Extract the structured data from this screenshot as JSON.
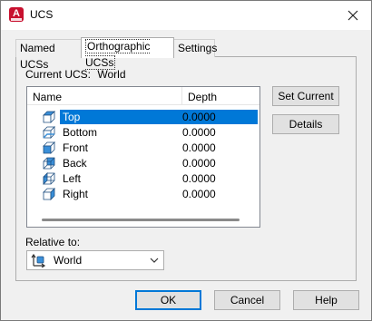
{
  "window": {
    "title": "UCS",
    "app_icon_letter": "A"
  },
  "tabs": [
    {
      "label": "Named UCSs",
      "active": false
    },
    {
      "label": "Orthographic UCSs",
      "active": true
    },
    {
      "label": "Settings",
      "active": false
    }
  ],
  "current_ucs": {
    "label": "Current UCS:",
    "value": "World"
  },
  "list": {
    "columns": {
      "name": "Name",
      "depth": "Depth"
    },
    "rows": [
      {
        "name": "Top",
        "depth": "0.0000",
        "selected": true
      },
      {
        "name": "Bottom",
        "depth": "0.0000",
        "selected": false
      },
      {
        "name": "Front",
        "depth": "0.0000",
        "selected": false
      },
      {
        "name": "Back",
        "depth": "0.0000",
        "selected": false
      },
      {
        "name": "Left",
        "depth": "0.0000",
        "selected": false
      },
      {
        "name": "Right",
        "depth": "0.0000",
        "selected": false
      }
    ]
  },
  "side_buttons": {
    "set_current": "Set Current",
    "details": "Details"
  },
  "relative_to": {
    "label": "Relative to:",
    "value": "World"
  },
  "footer_buttons": {
    "ok": "OK",
    "cancel": "Cancel",
    "help": "Help"
  },
  "colors": {
    "selection": "#0078d7",
    "app_icon": "#c8102e",
    "ucs_icon_face": "#3a8fd8"
  }
}
